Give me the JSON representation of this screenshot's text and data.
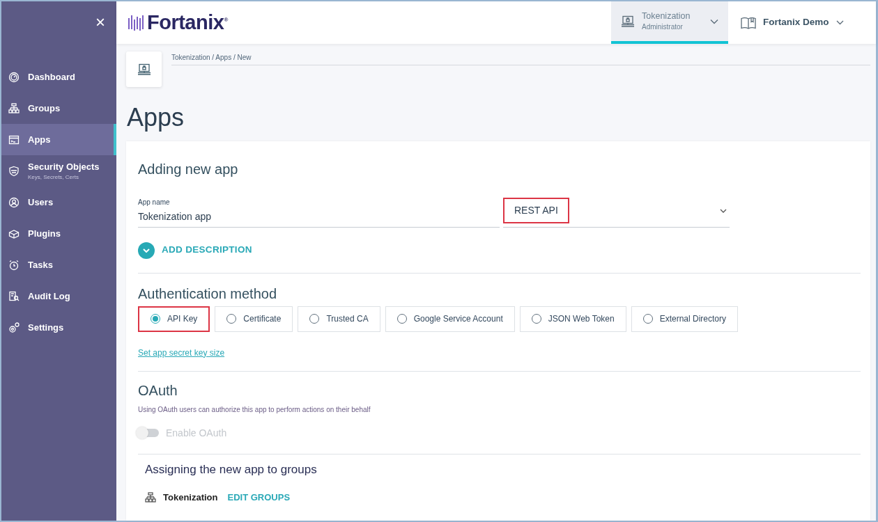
{
  "sidebar": {
    "close": "×",
    "items": [
      {
        "label": "Dashboard",
        "selected": false
      },
      {
        "label": "Groups",
        "selected": false
      },
      {
        "label": "Apps",
        "selected": true
      },
      {
        "label": "Security Objects",
        "sublabel": "Keys, Secrets, Certs",
        "selected": false
      },
      {
        "label": "Users",
        "selected": false
      },
      {
        "label": "Plugins",
        "selected": false
      },
      {
        "label": "Tasks",
        "selected": false
      },
      {
        "label": "Audit Log",
        "selected": false
      },
      {
        "label": "Settings",
        "selected": false
      }
    ]
  },
  "header": {
    "logo": "Fortanix",
    "logo_mark": "®",
    "account": {
      "name": "Tokenization",
      "role": "Administrator",
      "selected": true
    },
    "user": "Fortanix Demo"
  },
  "breadcrumb": "Tokenization / Apps / New",
  "page_title": "Apps",
  "form": {
    "title": "Adding new app",
    "app_name": {
      "label": "App name",
      "value": "Tokenization app"
    },
    "app_type": {
      "value": "REST API",
      "highlighted": true
    },
    "add_description": "ADD DESCRIPTION",
    "auth_title": "Authentication method",
    "auth_methods": [
      {
        "label": "API Key",
        "selected": true,
        "highlighted": true
      },
      {
        "label": "Certificate",
        "selected": false,
        "highlighted": false
      },
      {
        "label": "Trusted CA",
        "selected": false,
        "highlighted": false
      },
      {
        "label": "Google Service Account",
        "selected": false,
        "highlighted": false
      },
      {
        "label": "JSON Web Token",
        "selected": false,
        "highlighted": false
      },
      {
        "label": "External Directory",
        "selected": false,
        "highlighted": false
      }
    ],
    "secret_link": "Set app secret key size",
    "oauth": {
      "title": "OAuth",
      "description": "Using OAuth users can authorize this app to perform actions on their behalf",
      "toggle_label": "Enable OAuth",
      "on": false,
      "disabled": true
    },
    "groups": {
      "title": "Assigning the new app to groups",
      "group": "Tokenization",
      "edit": "EDIT GROUPS"
    }
  }
}
